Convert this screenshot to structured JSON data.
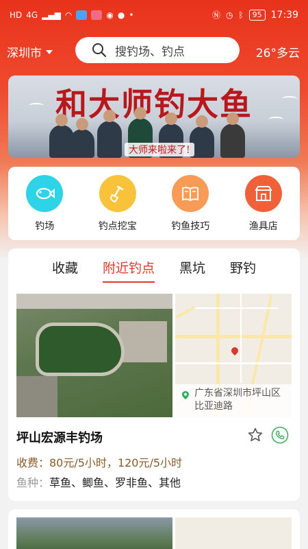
{
  "status_bar": {
    "time": "17:39",
    "battery": "95",
    "network": "HD",
    "signal": "4G"
  },
  "header": {
    "city": "深圳市",
    "search_placeholder": "搜钓场、钓点",
    "weather": "26°多云"
  },
  "banner": {
    "title": "和大师钓大鱼",
    "subtitle": "大师来啦来了!"
  },
  "categories": [
    {
      "label": "钓场",
      "icon": "fish-icon",
      "color": "#2fd3e8"
    },
    {
      "label": "钓点挖宝",
      "icon": "shovel-icon",
      "color": "#f8c33a"
    },
    {
      "label": "钓鱼技巧",
      "icon": "book-icon",
      "color": "#f79b56"
    },
    {
      "label": "渔具店",
      "icon": "shop-icon",
      "color": "#f0613a"
    }
  ],
  "tabs": [
    {
      "label": "收藏",
      "active": false
    },
    {
      "label": "附近钓点",
      "active": true
    },
    {
      "label": "黑坑",
      "active": false
    },
    {
      "label": "野钓",
      "active": false
    }
  ],
  "spot": {
    "name": "坪山宏源丰钓场",
    "address": "广东省深圳市坪山区比亚迪路",
    "fee": "收费：80元/5小时，120元/5小时",
    "fish_label": "鱼种：",
    "fish_value": "草鱼、鲫鱼、罗非鱼、其他"
  },
  "colors": {
    "brand_red": "#e4372a",
    "fee_color": "#8a5a28",
    "phone_green": "#3fae5a"
  }
}
